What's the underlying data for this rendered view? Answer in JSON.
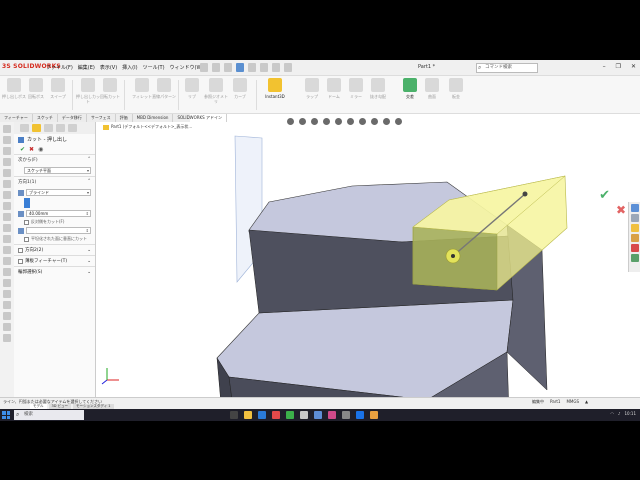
{
  "app": {
    "logo": "3S SOLIDWORKS",
    "menus": [
      "ファイル(F)",
      "編集(E)",
      "表示(V)",
      "挿入(I)",
      "ツール(T)",
      "ウィンドウ(W)"
    ],
    "doc_title": "Part1 *",
    "search_placeholder": "コマンド検索",
    "window_controls": [
      "–",
      "❐",
      "✕"
    ]
  },
  "commands": [
    {
      "label": "押し出しボス",
      "active": false
    },
    {
      "label": "回転ボス",
      "active": false
    },
    {
      "label": "スイープ",
      "active": false
    },
    {
      "label": "押し出しカット",
      "active": false
    },
    {
      "label": "回転カット",
      "active": false
    },
    {
      "label": "フィレット",
      "active": false
    },
    {
      "label": "直線パターン",
      "active": false
    },
    {
      "label": "リブ",
      "active": false
    },
    {
      "label": "参照ジオメトリ",
      "active": false
    },
    {
      "label": "カーブ",
      "active": false
    },
    {
      "label": "Instant3D",
      "active": true
    },
    {
      "label": "ラップ",
      "active": false
    },
    {
      "label": "ドーム",
      "active": false
    },
    {
      "label": "ミラー",
      "active": false
    },
    {
      "label": "抜き勾配",
      "active": false
    },
    {
      "label": "交差",
      "active": true
    },
    {
      "label": "曲面",
      "active": false
    },
    {
      "label": "板金",
      "active": false
    }
  ],
  "tabs": [
    "フィーチャー",
    "スケッチ",
    "データ移行",
    "サーフェス",
    "評価",
    "MBD Dimension",
    "SOLIDWORKS アドイン"
  ],
  "propmgr": {
    "title": "カット - 押し出し",
    "from_group": "次から(F)",
    "from_value": "スケッチ平面",
    "dir1_group": "方向1(1)",
    "end_condition": "ブラインド",
    "depth": "40.00mm",
    "flip_label": "反対側をカット(F)",
    "dir2_label": "方向2(2)",
    "thin_label": "薄板フィーチャー(T)",
    "contours_label": "輪郭選択(S)",
    "normal_cut": "平坦化された面に垂直にカット"
  },
  "graphics": {
    "tree_text": "Part1 (デフォルト<<デフォルト>_表示状..."
  },
  "statusbar": {
    "text": "ライン、円弧または必要なアイテムを選択してください",
    "right": [
      "編集中",
      "Part1",
      "MMGS",
      "▲"
    ],
    "bottom_tabs": [
      "モデル",
      "3D ビュー",
      "モーションスタディ 1"
    ]
  },
  "taskbar": {
    "search_placeholder": "検索",
    "time": "10:11",
    "date": "2022/08/10"
  },
  "colors": {
    "model_top": "#c5c8dd",
    "model_side": "#5e6070",
    "preview_yellow": "#f4f38f"
  }
}
